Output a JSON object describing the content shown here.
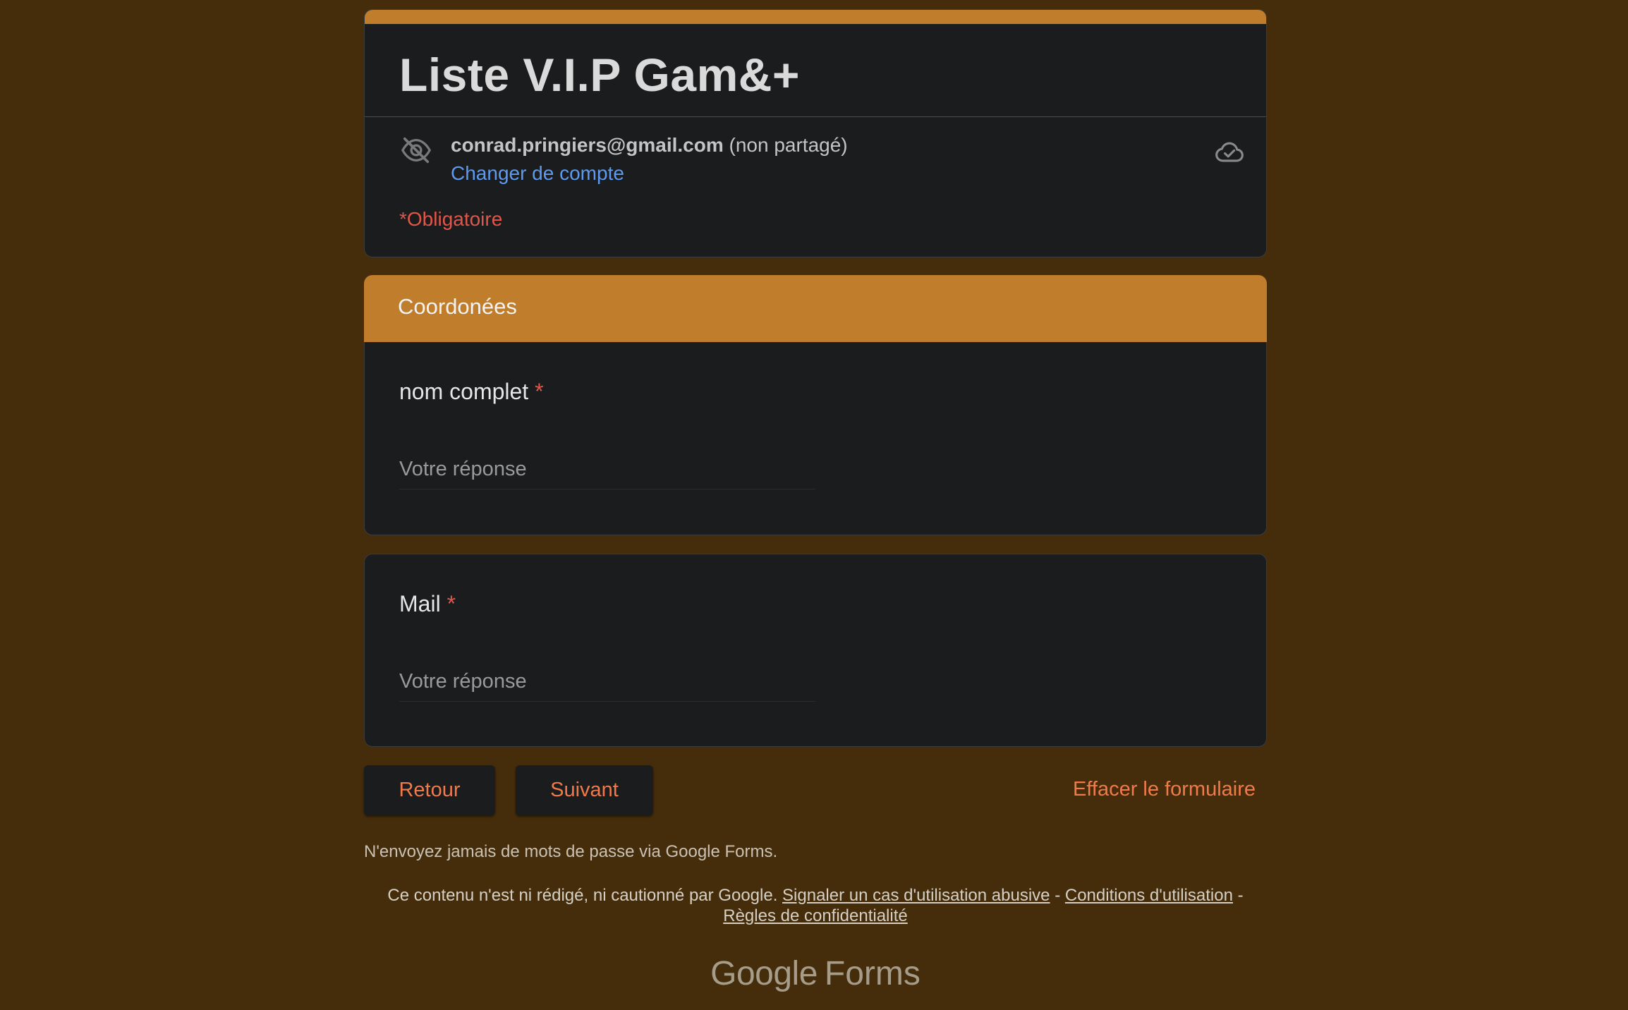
{
  "form": {
    "title": "Liste V.I.P Gam&+",
    "account_email": "conrad.pringiers@gmail.com",
    "account_status": "(non partagé)",
    "switch_account": "Changer de compte",
    "required_note": "*Obligatoire",
    "icons": {
      "visibility": "eye-off-icon",
      "cloud": "cloud-saved-icon"
    }
  },
  "section": {
    "title": "Coordonées"
  },
  "questions": [
    {
      "label": "nom complet",
      "required_mark": "*",
      "placeholder": "Votre réponse",
      "value": ""
    },
    {
      "label": "Mail",
      "required_mark": "*",
      "placeholder": "Votre réponse",
      "value": ""
    }
  ],
  "buttons": {
    "back": "Retour",
    "next": "Suivant",
    "clear": "Effacer le formulaire"
  },
  "footer": {
    "warning": "N'envoyez jamais de mots de passe via Google Forms.",
    "disclaimer": "Ce contenu n'est ni rédigé, ni cautionné par Google.",
    "report_abuse": "Signaler un cas d'utilisation abusive",
    "separator": "-",
    "terms": "Conditions d'utilisation",
    "privacy": "Règles de confidentialité",
    "logo_google": "Google",
    "logo_forms": "Forms"
  },
  "colors": {
    "background": "#452d0c",
    "accent": "#c07e2c",
    "card": "#1a1c1e",
    "link": "#5e9af0",
    "required": "#e0574a",
    "button_text": "#f07a4a"
  }
}
